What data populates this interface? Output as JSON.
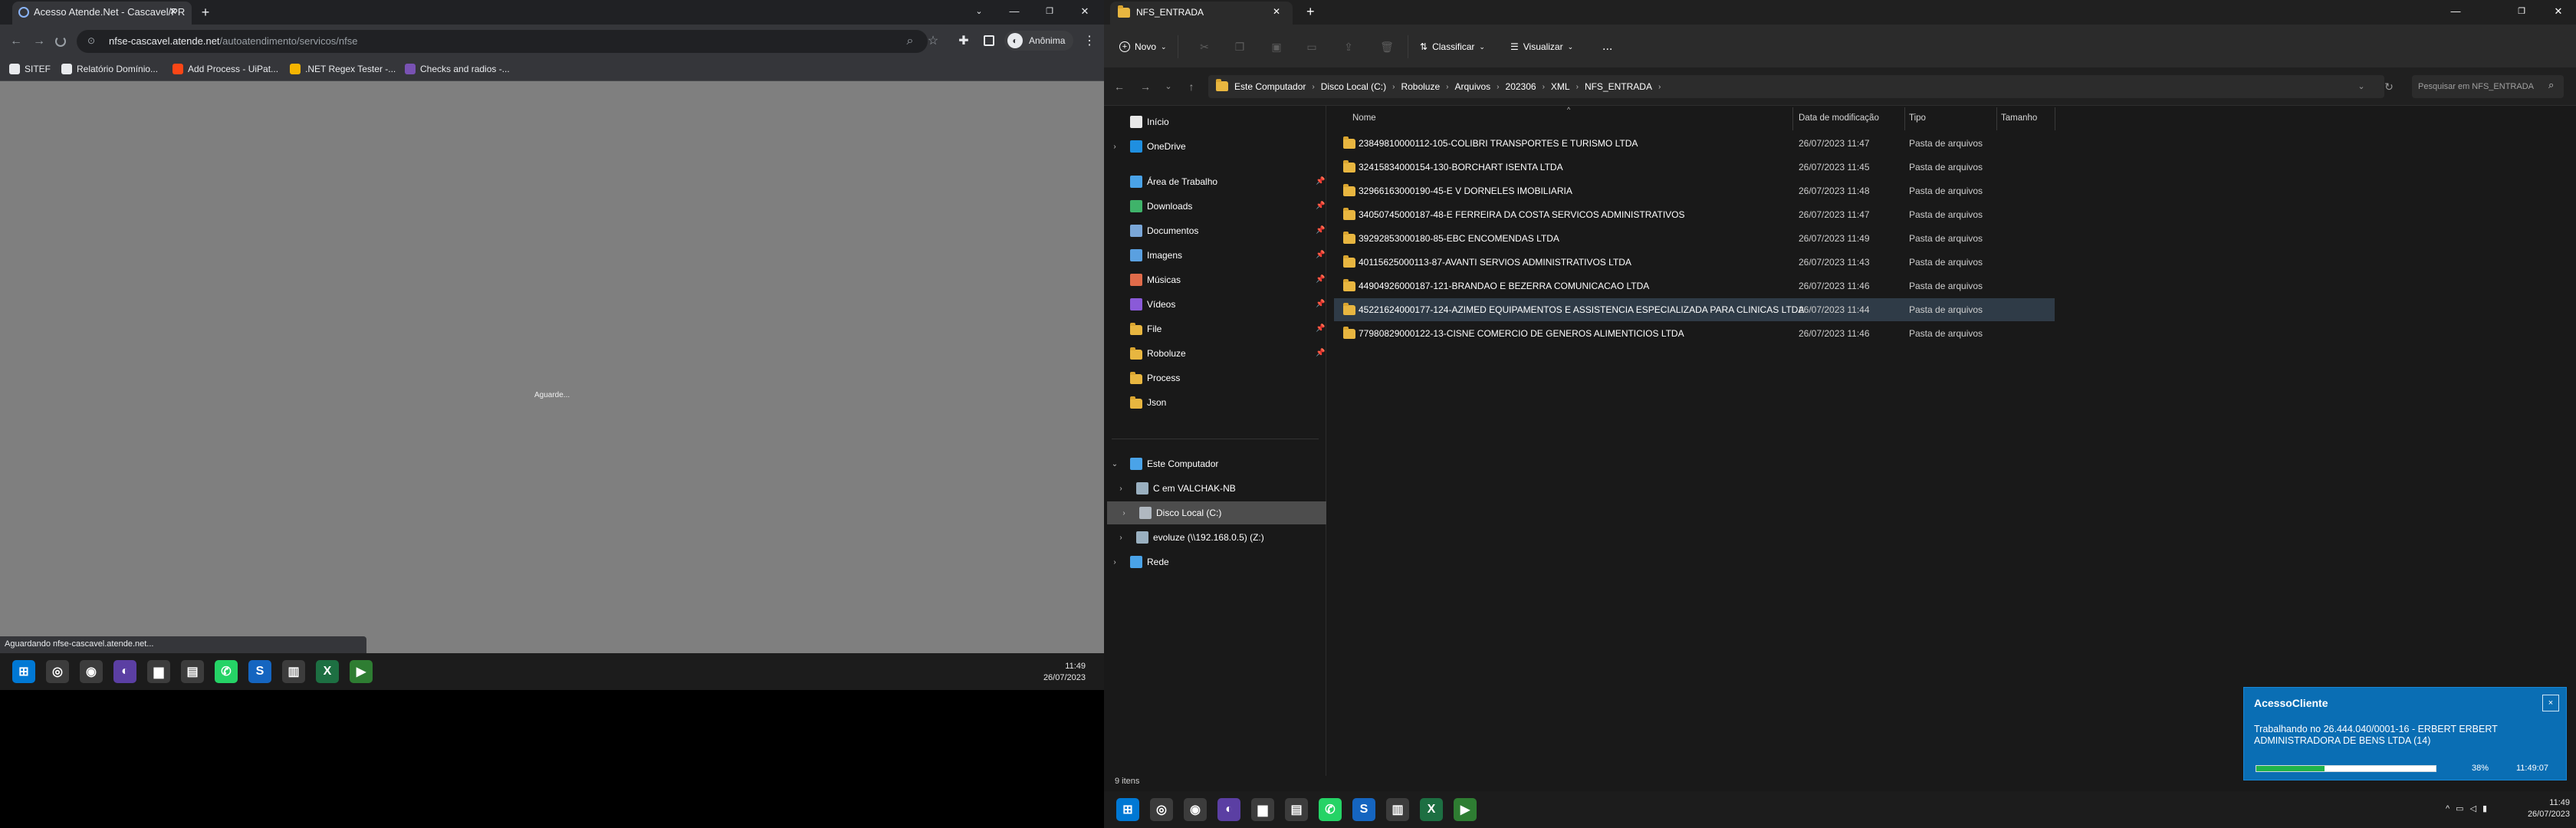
{
  "chrome": {
    "tab_title": "Acesso Atende.Net - Cascavel/PR",
    "url_host": "nfse-cascavel.atende.net",
    "url_path": "/autoatendimento/servicos/nfse",
    "profile_label": "Anônima",
    "bookmarks": [
      {
        "label": "SITEF",
        "icon": "grid-icon",
        "color": "#e8eaed"
      },
      {
        "label": "Relatório Domínio...",
        "icon": "globe-icon",
        "color": "#e8eaed"
      },
      {
        "label": "Add Process - UiPat...",
        "icon": "uipath-icon",
        "color": "#fa4616"
      },
      {
        "label": ".NET Regex Tester -...",
        "icon": "regex-icon",
        "color": "#f4b400"
      },
      {
        "label": "Checks and radios -...",
        "icon": "bootstrap-icon",
        "color": "#7952b3"
      }
    ],
    "page_text": "Aguarde...",
    "status_text": "Aguardando nfse-cascavel.atende.net..."
  },
  "left_taskbar": {
    "time": "11:49",
    "date": "26/07/2023"
  },
  "explorer": {
    "tab_title": "NFS_ENTRADA",
    "commands": {
      "new": "Novo",
      "sort": "Classificar",
      "view": "Visualizar",
      "more": "..."
    },
    "breadcrumbs": [
      "Este Computador",
      "Disco Local (C:)",
      "Roboluze",
      "Arquivos",
      "202306",
      "XML",
      "NFS_ENTRADA"
    ],
    "search_placeholder": "Pesquisar em NFS_ENTRADA",
    "nav": [
      {
        "label": "Início",
        "icon": "home-icon",
        "pinned": false
      },
      {
        "label": "OneDrive",
        "icon": "onedrive-icon",
        "pinned": false
      },
      {
        "label": "Área de Trabalho",
        "icon": "desktop-icon",
        "pinned": true
      },
      {
        "label": "Downloads",
        "icon": "downloads-icon",
        "pinned": true
      },
      {
        "label": "Documentos",
        "icon": "documents-icon",
        "pinned": true
      },
      {
        "label": "Imagens",
        "icon": "pictures-icon",
        "pinned": true
      },
      {
        "label": "Músicas",
        "icon": "music-icon",
        "pinned": true
      },
      {
        "label": "Vídeos",
        "icon": "videos-icon",
        "pinned": true
      },
      {
        "label": "File",
        "icon": "folder-icon",
        "pinned": true
      },
      {
        "label": "Roboluze",
        "icon": "folder-icon",
        "pinned": true
      },
      {
        "label": "Process",
        "icon": "folder-icon",
        "pinned": false
      },
      {
        "label": "Json",
        "icon": "folder-icon",
        "pinned": false
      }
    ],
    "tree": [
      {
        "label": "Este Computador",
        "icon": "computer-icon"
      },
      {
        "label": "C em VALCHAK-NB",
        "icon": "network-drive-icon"
      },
      {
        "label": "Disco Local (C:)",
        "icon": "local-disk-icon"
      },
      {
        "label": "evoluze (\\\\192.168.0.5) (Z:)",
        "icon": "network-drive-icon"
      },
      {
        "label": "Rede",
        "icon": "network-icon"
      }
    ],
    "columns": {
      "name": "Nome",
      "date": "Data de modificação",
      "type": "Tipo",
      "size": "Tamanho"
    },
    "files": [
      {
        "name": "23849810000112-105-COLIBRI TRANSPORTES E TURISMO LTDA",
        "date": "26/07/2023 11:47",
        "type": "Pasta de arquivos"
      },
      {
        "name": "32415834000154-130-BORCHART ISENTA LTDA",
        "date": "26/07/2023 11:45",
        "type": "Pasta de arquivos"
      },
      {
        "name": "32966163000190-45-E V DORNELES IMOBILIARIA",
        "date": "26/07/2023 11:48",
        "type": "Pasta de arquivos"
      },
      {
        "name": "34050745000187-48-E FERREIRA DA COSTA SERVICOS ADMINISTRATIVOS",
        "date": "26/07/2023 11:47",
        "type": "Pasta de arquivos"
      },
      {
        "name": "39292853000180-85-EBC ENCOMENDAS LTDA",
        "date": "26/07/2023 11:49",
        "type": "Pasta de arquivos"
      },
      {
        "name": "40115625000113-87-AVANTI SERVIOS ADMINISTRATIVOS LTDA",
        "date": "26/07/2023 11:43",
        "type": "Pasta de arquivos"
      },
      {
        "name": "44904926000187-121-BRANDAO E BEZERRA COMUNICACAO LTDA",
        "date": "26/07/2023 11:46",
        "type": "Pasta de arquivos"
      },
      {
        "name": "45221624000177-124-AZIMED EQUIPAMENTOS E ASSISTENCIA ESPECIALIZADA PARA CLINICAS LTDA",
        "date": "26/07/2023 11:44",
        "type": "Pasta de arquivos"
      },
      {
        "name": "77980829000122-13-CISNE COMERCIO DE GENEROS ALIMENTICIOS LTDA",
        "date": "26/07/2023 11:46",
        "type": "Pasta de arquivos"
      }
    ],
    "item_count": "9 itens"
  },
  "toast": {
    "title": "AcessoCliente",
    "close_label": "×",
    "message": "Trabalhando no 26.444.040/0001-16 - ERBERT ERBERT ADMINISTRADORA DE BENS LTDA (14)",
    "progress": 0.38,
    "percent_text": "38%",
    "time": "11:49:07"
  },
  "right_taskbar": {
    "time": "11:49",
    "date": "26/07/2023"
  },
  "colors": {
    "toast_bg": "#0a6eb4",
    "progress_green": "#1fb34a",
    "selection": "#2f3b47"
  }
}
